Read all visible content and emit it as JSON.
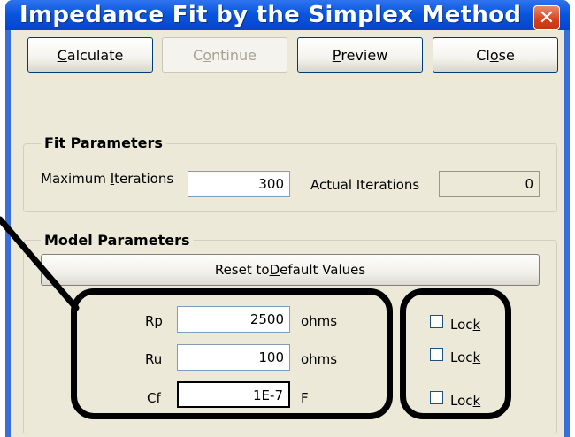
{
  "window": {
    "title": "Impedance Fit by the Simplex Method",
    "close_glyph": "✕"
  },
  "buttons": {
    "calculate": {
      "pre": "",
      "key": "C",
      "post": "alculate"
    },
    "continue": {
      "pre": "C",
      "key": "o",
      "post": "ntinue"
    },
    "preview": {
      "pre": "",
      "key": "P",
      "post": "review"
    },
    "close": {
      "pre": "Cl",
      "key": "o",
      "post": "se"
    }
  },
  "fit_parameters": {
    "legend": "Fit Parameters",
    "max_iterations_label": {
      "pre": "Maximum ",
      "key": "I",
      "post": "terations"
    },
    "max_iterations_value": "300",
    "actual_iterations_label": "Actual Iterations",
    "actual_iterations_value": "0"
  },
  "model_parameters": {
    "legend": "Model Parameters",
    "reset_button": {
      "pre": "Reset to ",
      "key": "D",
      "post": "efault Values"
    },
    "rows": [
      {
        "name": "Rp",
        "value": "2500",
        "unit": "ohms",
        "lock": {
          "pre": "Loc",
          "key": "k",
          "post": ""
        }
      },
      {
        "name": "Ru",
        "value": "100",
        "unit": "ohms",
        "lock": {
          "pre": "Loc",
          "key": "k",
          "post": ""
        }
      },
      {
        "name": "Cf",
        "value": "1E-7",
        "unit": "F",
        "lock": {
          "pre": "Loc",
          "key": "k",
          "post": ""
        }
      }
    ]
  }
}
